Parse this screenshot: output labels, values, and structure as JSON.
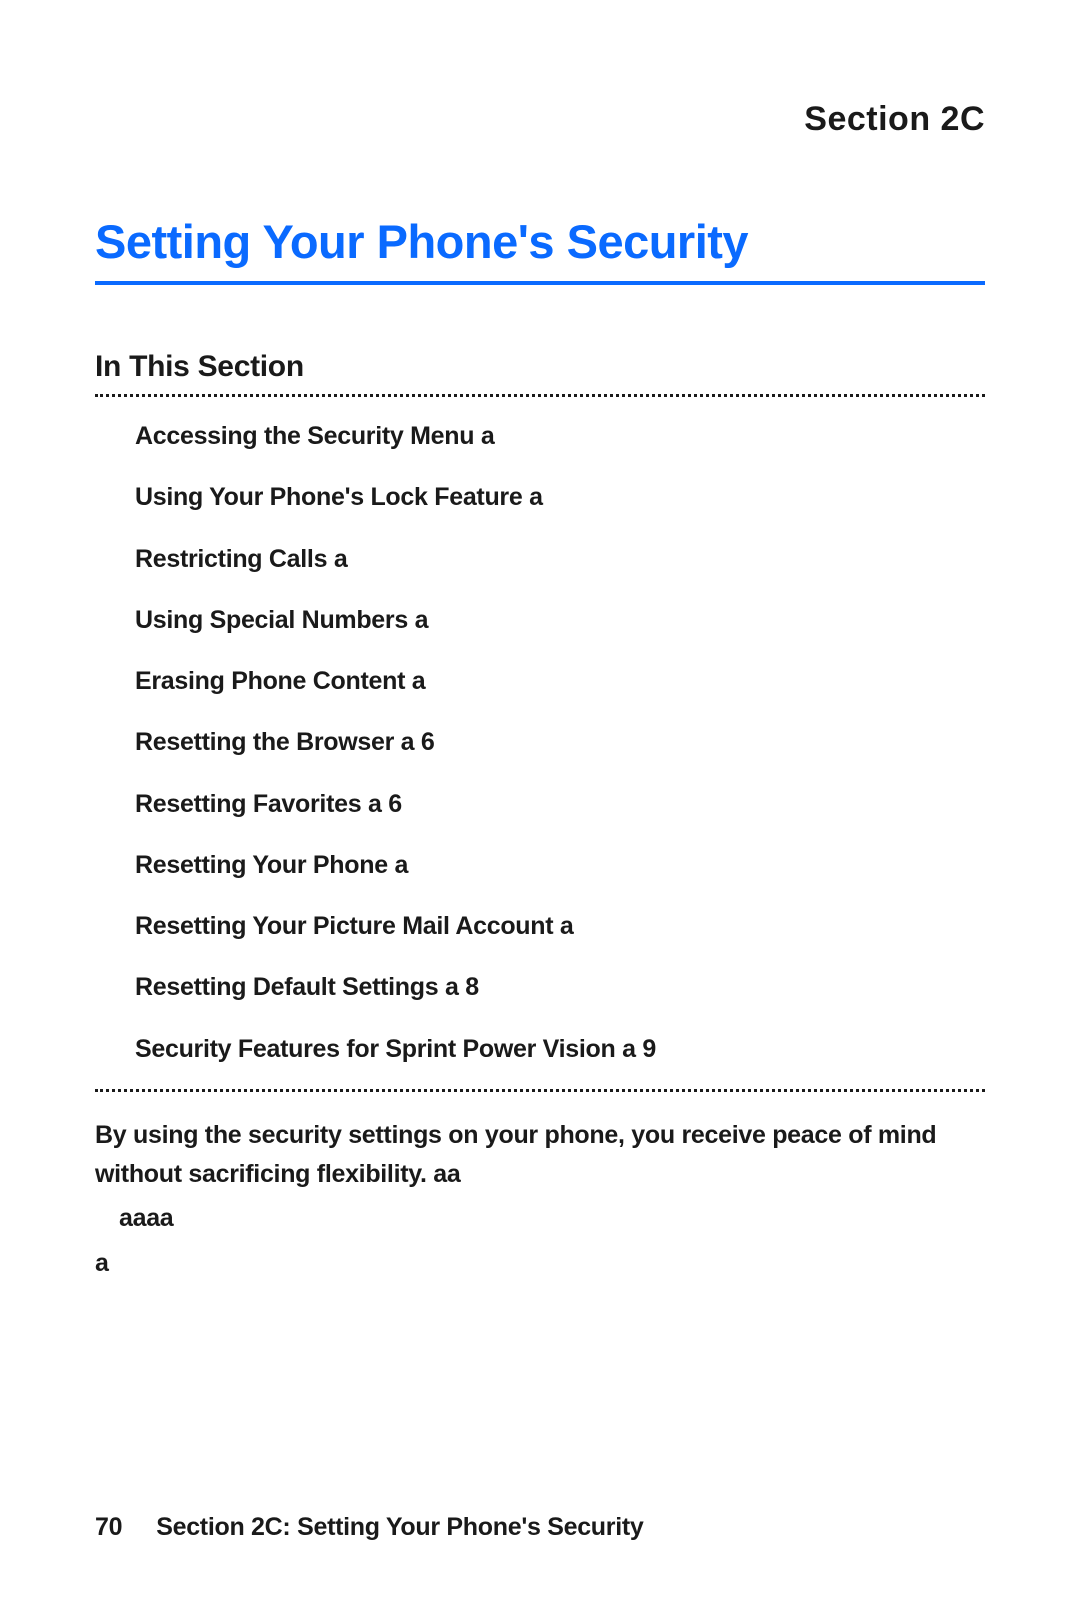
{
  "section_label": "Section 2C",
  "page_title": "Setting Your Phone's Security",
  "subsection_heading": "In This Section",
  "toc": [
    "Accessing the Security Menu   a",
    "Using Your Phone's Lock Feature   a",
    "Restricting Calls   a",
    "Using Special Numbers   a",
    "Erasing Phone Content   a",
    "Resetting the Browser   a  6",
    "Resetting Favorites   a  6",
    "Resetting Your Phone   a",
    "Resetting Your Picture Mail Account   a",
    "Resetting Default Settings   a  8",
    "Security Features for Sprint Power Vision   a  9"
  ],
  "body_lines": [
    "By using the security settings on your phone, you receive peace of mind without sacrificing flexibility.  aa",
    "aaaa",
    "a"
  ],
  "footer": {
    "page_number": "70",
    "text": "Section 2C: Setting Your Phone's Security"
  }
}
